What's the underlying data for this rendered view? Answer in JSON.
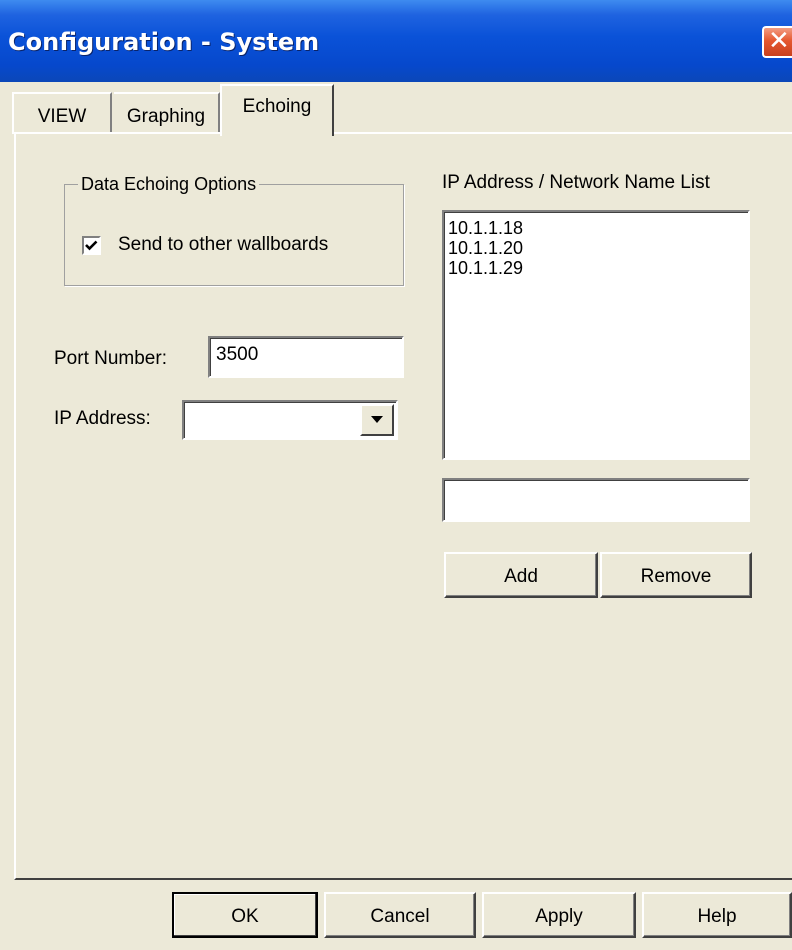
{
  "window": {
    "title": "Configuration - System",
    "close_icon": "close-icon"
  },
  "tabs": [
    {
      "label": "VIEW",
      "active": false
    },
    {
      "label": "Graphing",
      "active": false
    },
    {
      "label": "Echoing",
      "active": true
    }
  ],
  "echoing": {
    "group_label": "Data Echoing Options",
    "send_checkbox": {
      "label": "Send to other wallboards",
      "checked": true
    },
    "port_label": "Port Number:",
    "port_value": "3500",
    "ip_label": "IP Address:",
    "ip_value": "",
    "list_label": "IP Address / Network Name List",
    "list_items": [
      "10.1.1.18",
      "10.1.1.20",
      "10.1.1.29"
    ],
    "new_entry_value": "",
    "add_label": "Add",
    "remove_label": "Remove"
  },
  "footer": {
    "ok_label": "OK",
    "cancel_label": "Cancel",
    "apply_label": "Apply",
    "help_label": "Help"
  },
  "colors": {
    "title_bar": "#0a52d8",
    "dialog_bg": "#ece9d8",
    "close_button": "#e5582f"
  }
}
